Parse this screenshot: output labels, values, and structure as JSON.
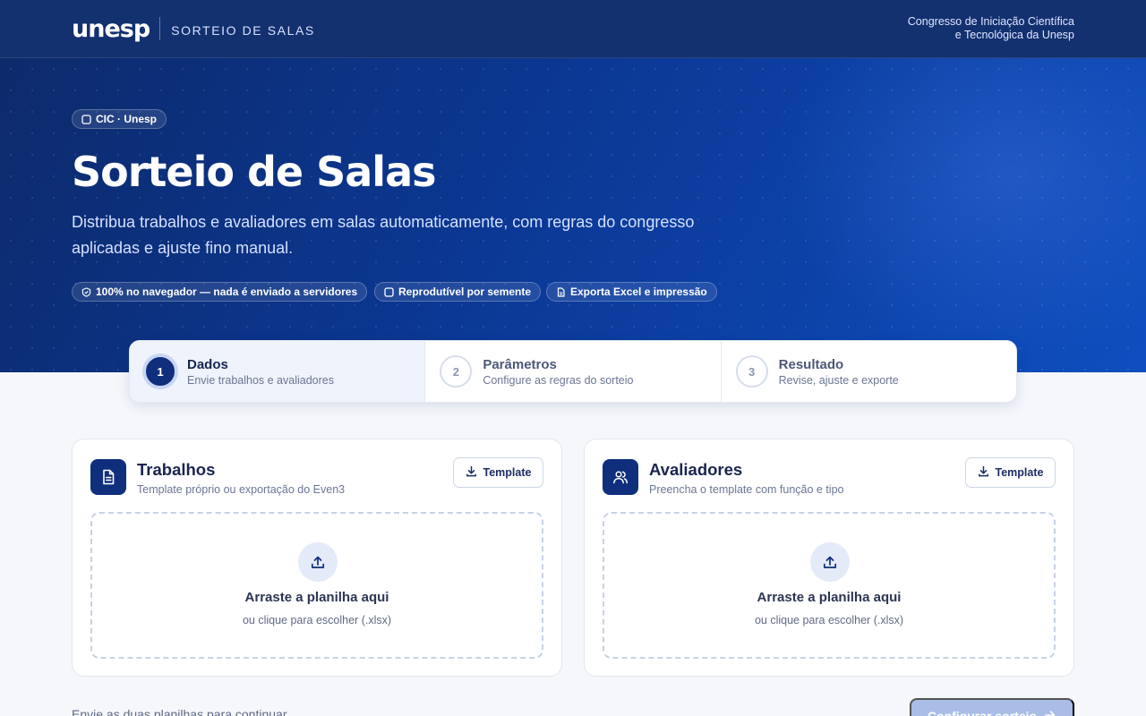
{
  "header": {
    "brand": "unesp",
    "app_name": "SORTEIO DE SALAS",
    "org_line1": "Congresso de Iniciação Científica",
    "org_line2": "e Tecnológica da Unesp"
  },
  "hero": {
    "tag": "CIC · Unesp",
    "title": "Sorteio de Salas",
    "subtitle": "Distribua trabalhos e avaliadores em salas automaticamente, com regras do congresso aplicadas e ajuste fino manual.",
    "features": [
      {
        "icon": "shield-check-icon",
        "label": "100% no navegador — nada é enviado a servidores"
      },
      {
        "icon": "square-icon",
        "label": "Reprodutível por semente"
      },
      {
        "icon": "document-icon",
        "label": "Exporta Excel e impressão"
      }
    ]
  },
  "stepper": {
    "steps": [
      {
        "number": "1",
        "title": "Dados",
        "description": "Envie trabalhos e avaliadores",
        "active": true
      },
      {
        "number": "2",
        "title": "Parâmetros",
        "description": "Configure as regras do sorteio",
        "active": false
      },
      {
        "number": "3",
        "title": "Resultado",
        "description": "Revise, ajuste e exporte",
        "active": false
      }
    ]
  },
  "cards": {
    "trabalhos": {
      "icon": "document-icon",
      "title": "Trabalhos",
      "subtitle": "Template próprio ou exportação do Even3",
      "template_label": "Template",
      "drop_title": "Arraste a planilha aqui",
      "drop_subtitle": "ou clique para escolher (.xlsx)"
    },
    "avaliadores": {
      "icon": "users-icon",
      "title": "Avaliadores",
      "subtitle": "Preencha o template com função e tipo",
      "template_label": "Template",
      "drop_title": "Arraste a planilha aqui",
      "drop_subtitle": "ou clique para escolher (.xlsx)"
    }
  },
  "footer": {
    "hint": "Envie as duas planilhas para continuar",
    "next_label": "Configurar sorteio",
    "next_icon": "arrow-right-icon"
  },
  "colors": {
    "primary": "#0f2f7d",
    "header_bg": "#13306f",
    "hero_start": "#0d2a6b",
    "hero_end": "#0e4ebf",
    "page_bg": "#f5f7fb",
    "disabled_button": "#a9bde6"
  }
}
